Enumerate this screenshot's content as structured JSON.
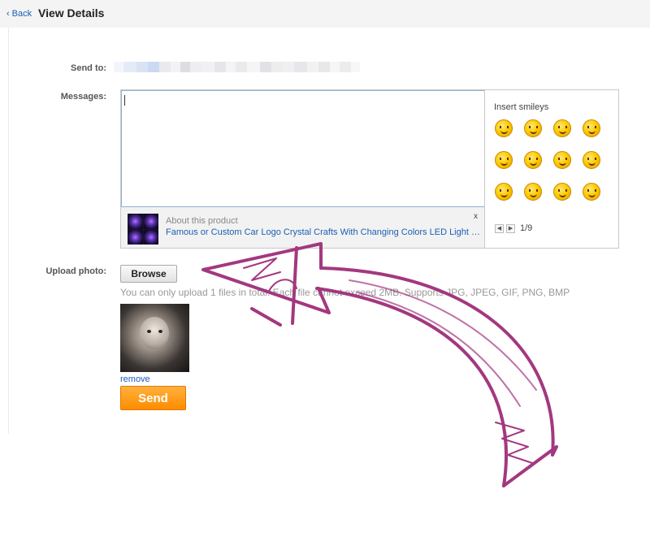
{
  "header": {
    "back_label": "Back",
    "title": "View Details"
  },
  "form": {
    "send_to_label": "Send to:",
    "messages_label": "Messages:",
    "upload_label": "Upload photo:",
    "product": {
      "about_label": "About this product",
      "name": "Famous or Custom Car Logo Crystal Crafts With Changing Colors LED Light La...",
      "close": "x"
    },
    "smileys": {
      "title": "Insert smileys",
      "page": "1/9",
      "prev": "◀",
      "next": "▶"
    },
    "upload": {
      "browse_label": "Browse",
      "note": "You can only upload 1 files in total. Each file cannot exceed 2MB. Supports JPG, JPEG, GIF, PNG, BMP",
      "remove_label": "remove"
    },
    "send_label": "Send"
  },
  "colors": {
    "link": "#1a5fb4",
    "send_button": "#ff9a1a",
    "arrow": "#a3387f"
  },
  "icons": {
    "back": "chevron-left-icon",
    "smiley": "smiley-icon",
    "annotation": "hand-drawn-arrow"
  }
}
